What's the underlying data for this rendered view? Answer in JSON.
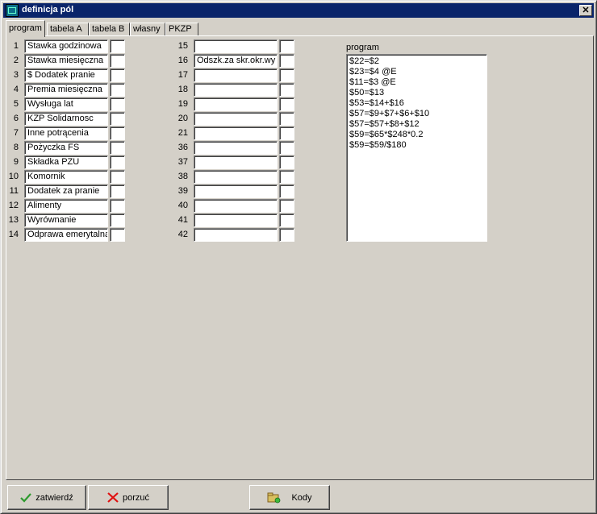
{
  "window": {
    "title": "definicja pól",
    "close_glyph": "✕"
  },
  "tabs": [
    {
      "label": "program",
      "active": true
    },
    {
      "label": "tabela A"
    },
    {
      "label": "tabela B"
    },
    {
      "label": "własny"
    },
    {
      "label": "PKZP"
    }
  ],
  "left_fields": [
    {
      "num": "1",
      "name": "Stawka godzinowa",
      "flag": ""
    },
    {
      "num": "2",
      "name": "Stawka miesięczna",
      "flag": ""
    },
    {
      "num": "3",
      "name": "$ Dodatek pranie",
      "flag": ""
    },
    {
      "num": "4",
      "name": "Premia miesięczna",
      "flag": ""
    },
    {
      "num": "5",
      "name": "Wysługa lat",
      "flag": ""
    },
    {
      "num": "6",
      "name": "KZP Solidarnosc",
      "flag": ""
    },
    {
      "num": "7",
      "name": "Inne potrącenia",
      "flag": ""
    },
    {
      "num": "8",
      "name": "Pożyczka FS",
      "flag": ""
    },
    {
      "num": "9",
      "name": "Składka PZU",
      "flag": ""
    },
    {
      "num": "10",
      "name": "Komornik",
      "flag": ""
    },
    {
      "num": "11",
      "name": "Dodatek za pranie",
      "flag": ""
    },
    {
      "num": "12",
      "name": "Alimenty",
      "flag": ""
    },
    {
      "num": "13",
      "name": "Wyrównanie",
      "flag": ""
    },
    {
      "num": "14",
      "name": "Odprawa emerytalna",
      "flag": ""
    }
  ],
  "right_fields": [
    {
      "num": "15",
      "name": "",
      "flag": ""
    },
    {
      "num": "16",
      "name": "Odszk.za skr.okr.wy",
      "flag": ""
    },
    {
      "num": "17",
      "name": "",
      "flag": ""
    },
    {
      "num": "18",
      "name": "",
      "flag": ""
    },
    {
      "num": "19",
      "name": "",
      "flag": ""
    },
    {
      "num": "20",
      "name": "",
      "flag": ""
    },
    {
      "num": "21",
      "name": "",
      "flag": ""
    },
    {
      "num": "36",
      "name": "",
      "flag": ""
    },
    {
      "num": "37",
      "name": "",
      "flag": ""
    },
    {
      "num": "38",
      "name": "",
      "flag": ""
    },
    {
      "num": "39",
      "name": "",
      "flag": ""
    },
    {
      "num": "40",
      "name": "",
      "flag": ""
    },
    {
      "num": "41",
      "name": "",
      "flag": ""
    },
    {
      "num": "42",
      "name": "",
      "flag": ""
    }
  ],
  "program": {
    "label": "program",
    "lines": [
      "$22=$2",
      "$23=$4 @E",
      "$11=$3 @E",
      "$50=$13",
      "$53=$14+$16",
      "$57=$9+$7+$6+$10",
      "$57=$57+$8+$12",
      "$59=$65*$248*0.2",
      "$59=$59/$180"
    ]
  },
  "buttons": {
    "confirm": {
      "label": "zatwierdź",
      "icon": "check-icon",
      "color": "#2e9a2e"
    },
    "cancel": {
      "label": "porzuć",
      "icon": "x-icon",
      "color": "#e01010"
    },
    "codes": {
      "label": "Kody",
      "icon": "folder-icon",
      "color": "#d8c060"
    }
  }
}
